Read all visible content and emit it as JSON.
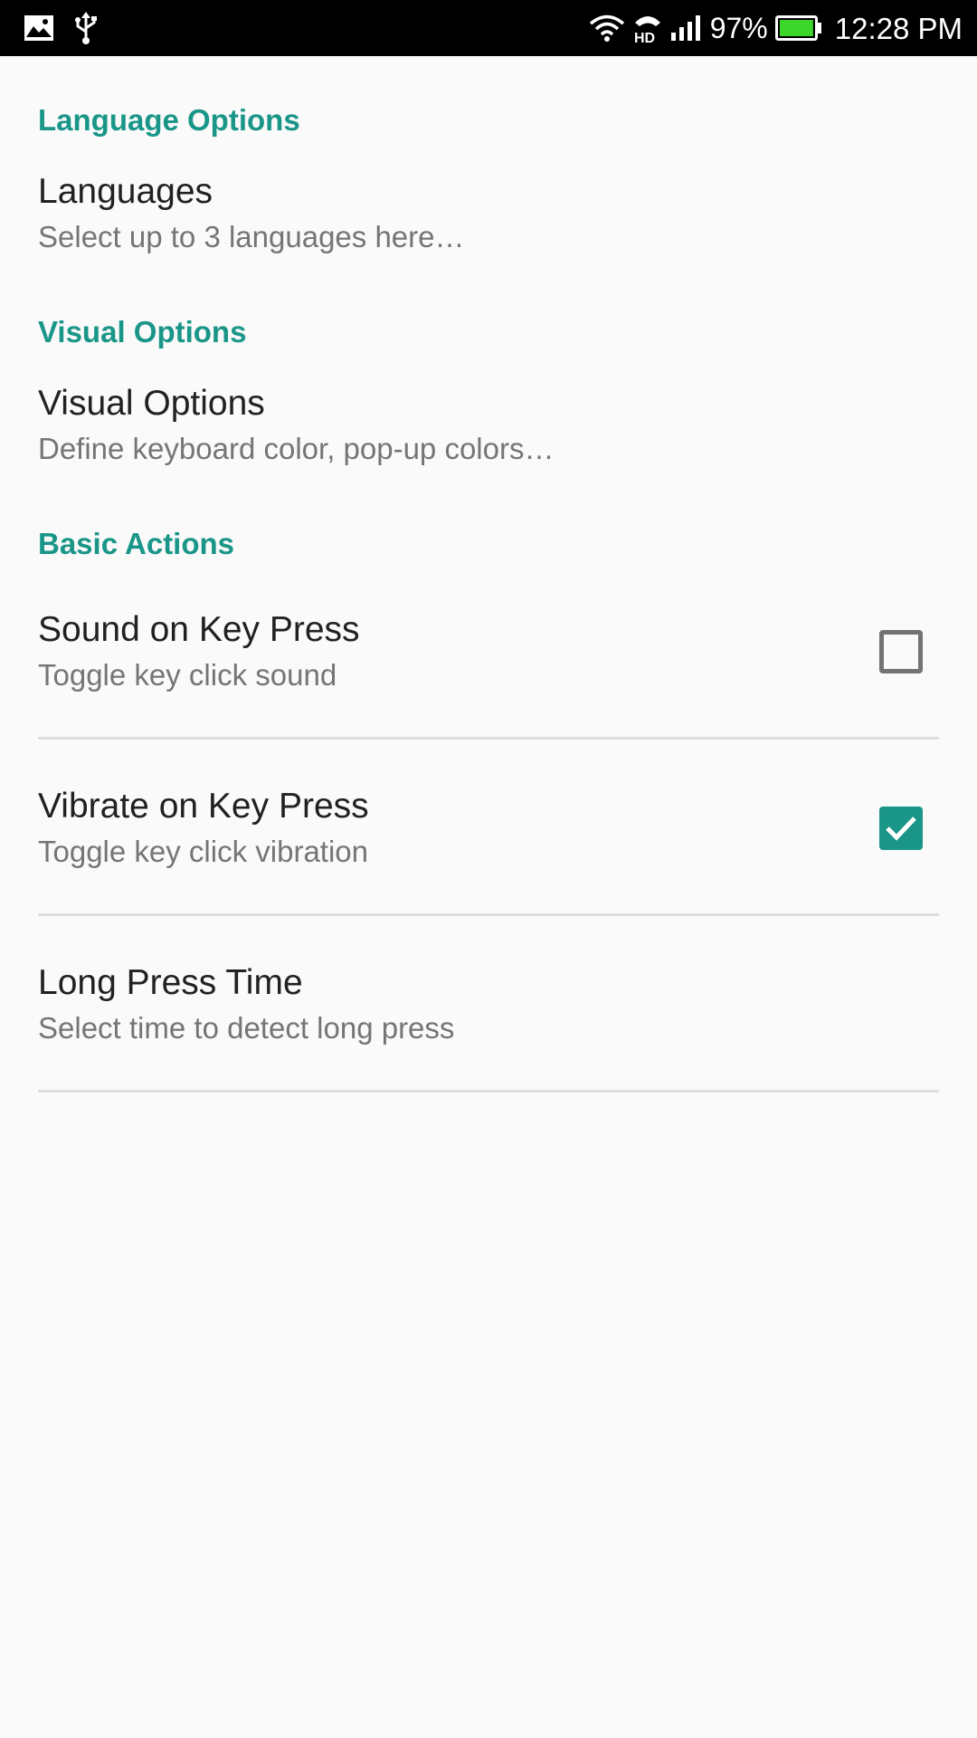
{
  "status_bar": {
    "icons_left": [
      "image-icon",
      "usb-icon"
    ],
    "icons_right": [
      "wifi-icon",
      "hd-voice-icon",
      "signal-icon",
      "battery-icon"
    ],
    "battery_percent": "97%",
    "time": "12:28 PM",
    "battery_level": 0.97,
    "battery_color": "#3cd62a"
  },
  "accent_color": "#1a9688",
  "categories": {
    "language": {
      "header": "Language Options",
      "languages": {
        "title": "Languages",
        "summary": "Select up to 3 languages here…"
      }
    },
    "visual": {
      "header": "Visual Options",
      "visual_options": {
        "title": "Visual Options",
        "summary": "Define keyboard color, pop-up colors…"
      }
    },
    "basic": {
      "header": "Basic Actions",
      "sound": {
        "title": "Sound on Key Press",
        "summary": "Toggle key click sound",
        "checked": false
      },
      "vibrate": {
        "title": "Vibrate on Key Press",
        "summary": "Toggle key click vibration",
        "checked": true
      },
      "long_press": {
        "title": "Long Press Time",
        "summary": "Select time to detect long press"
      }
    }
  }
}
